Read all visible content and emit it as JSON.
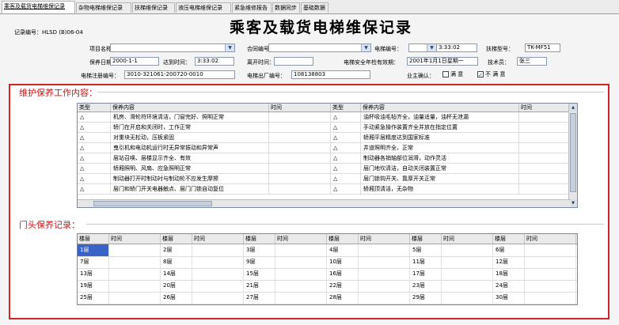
{
  "tabs": [
    "乘客及载货电梯维保记录",
    "杂物电梯维保记录",
    "扶梯维保记录",
    "液压电梯维保记录",
    "紧急维修报告",
    "数据同步",
    "基础数据"
  ],
  "header": {
    "record_no_label": "记录编号：",
    "record_no": "HLSD (B)06-04",
    "title": "乘客及载货电梯维保记录"
  },
  "form": {
    "project_name_label": "项目名称：",
    "project_name": "",
    "contract_no_label": "合同编号：",
    "contract_no": "",
    "elevator_no_label": "电梯编号：",
    "elevator_no": "",
    "elevator_time": "3:33:02",
    "model_label": "扶梯型号：",
    "model": "TK-MF51",
    "service_date_label": "保养日期：",
    "service_date": "2000-1-1",
    "arrive_time_label": "达到时间：",
    "arrive_time": "3:33:02",
    "leave_time_label": "离开时间：",
    "leave_time": "",
    "safety_expiry_label": "电梯安全年检有效期：",
    "safety_expiry": "2001年1月1日星期一",
    "technician_label": "技术员：",
    "technician": "张三",
    "reg_no_label": "电梯注册编号：",
    "reg_no": "3010-321061-200720-0010",
    "factory_no_label": "电梯出厂编号：",
    "factory_no": "108138803",
    "owner_confirm_label": "业主确认：",
    "satisfied_label": "满 意",
    "satisfied_checked": false,
    "unsatisfied_label": "不 满 意",
    "unsatisfied_checked": true
  },
  "maintenance": {
    "section_title": "维护保养工作内容：",
    "columns": [
      "类型",
      "保养内容",
      "时间",
      "类型",
      "保养内容",
      "时间"
    ],
    "rows": [
      [
        "△",
        "机房、滑轮符环境清洁，门窗完好、照明正常",
        "",
        "△",
        "油杯吸油毛毡齐全，油量适量，油杯无泄漏",
        ""
      ],
      [
        "△",
        "轿门在开启和关闭时，工作正常",
        "",
        "△",
        "手动紧急操作装置齐全并放在指定位置",
        ""
      ],
      [
        "△",
        "对重块无松动，压板紧固",
        "",
        "△",
        "轿厢平层精度达到国家标准",
        ""
      ],
      [
        "△",
        "曳引机和电动机运行时无异常振动和异常声",
        "",
        "△",
        "井道照明齐全，正常",
        ""
      ],
      [
        "△",
        "层站召唤、层楼显示齐全、有效",
        "",
        "△",
        "制动器各销轴部位润滑，动作灵活",
        ""
      ],
      [
        "△",
        "轿厢照明、风扇、应急照明正常",
        "",
        "△",
        "层门地坎清洁，自动关闭装置正常",
        ""
      ],
      [
        "△",
        "制动器打开时制动衬与制动轮不应发生摩擦",
        "",
        "△",
        "层门锁钩开关、靠厚开关正常",
        ""
      ],
      [
        "△",
        "层门和轿门开关电器触点、层门门锁自动复位",
        "",
        "△",
        "轿厢顶清洁，无杂物",
        ""
      ]
    ]
  },
  "floors": {
    "section_title": "门头保养记录：",
    "header": [
      "楼层",
      "时间",
      "楼层",
      "时间",
      "楼层",
      "时间",
      "楼层",
      "时间",
      "楼层",
      "时间",
      "楼层",
      "时间"
    ],
    "rows": [
      [
        "1层",
        "2层",
        "3层",
        "4层",
        "5层",
        "6层"
      ],
      [
        "7层",
        "8层",
        "9层",
        "10层",
        "11层",
        "12层"
      ],
      [
        "13层",
        "14层",
        "15层",
        "16层",
        "17层",
        "18层"
      ],
      [
        "19层",
        "20层",
        "21层",
        "22层",
        "23层",
        "24层"
      ],
      [
        "25层",
        "26层",
        "27层",
        "28层",
        "29层",
        "30层"
      ]
    ]
  },
  "colors": {
    "highlight": "#d3232a",
    "section_title": "#c81818",
    "selected_row": "#3a63c8"
  }
}
